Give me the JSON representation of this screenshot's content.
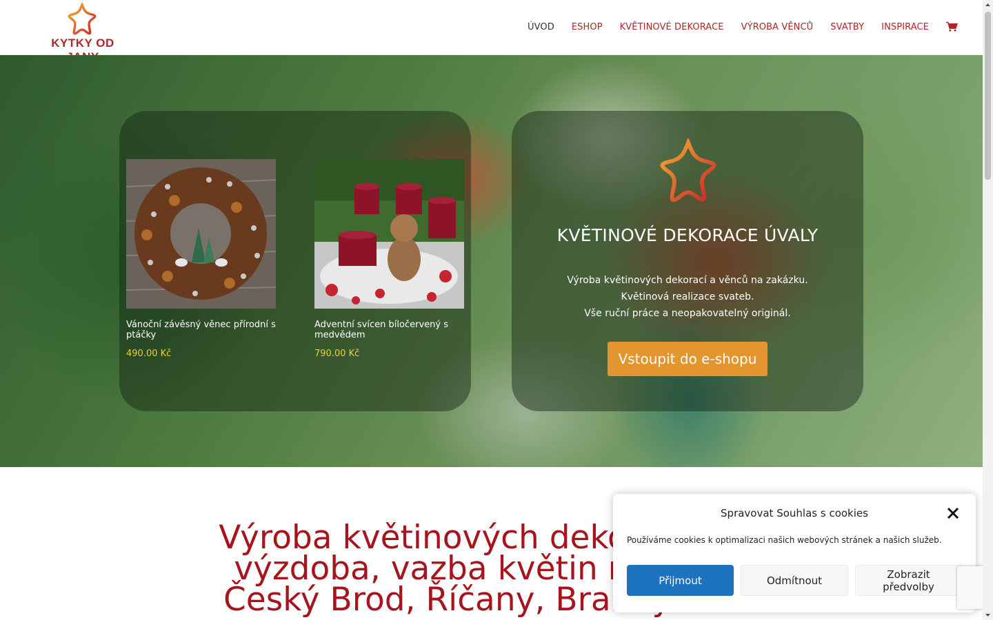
{
  "brand": {
    "name": "KYTKY OD JANY"
  },
  "nav": {
    "items": [
      {
        "label": "ÚVOD"
      },
      {
        "label": "ESHOP"
      },
      {
        "label": "KVĚTINOVÉ  DEKORACE"
      },
      {
        "label": "VÝROBA VĚNCŮ"
      },
      {
        "label": "SVATBY"
      },
      {
        "label": "INSPIRACE"
      }
    ],
    "cart_icon": "shopping-cart-icon"
  },
  "products": [
    {
      "name": "Vánoční závěsný věnec přírodní s ptáčky",
      "price": "490.00 Kč",
      "image": "christmas-wreath"
    },
    {
      "name": "Adventní svícen bíločervený s medvědem",
      "price": "790.00 Kč",
      "image": "advent-candle-holder"
    }
  ],
  "hero": {
    "title": "KVĚTINOVÉ  DEKORACE ÚVALY",
    "lines": [
      "Výroba květinových dekorací a věnců na zakázku.",
      "Květinová realizace svateb.",
      "Vše ruční práce a neopakovatelný originál."
    ],
    "cta": "Vstoupit do e-shopu"
  },
  "section": {
    "heading_lines": [
      "Výroba květinových dekorací, sva",
      "výzdoba, vazba květin na objed",
      "Český Brod, Říčany, Brandýs nad"
    ]
  },
  "cookie": {
    "title": "Spravovat Souhlas s cookies",
    "text": "Používáme cookies k optimalizaci našich webových stránek a našich služeb.",
    "accept": "Přijmout",
    "deny": "Odmítnout",
    "prefs": "Zobrazit předvolby"
  },
  "colors": {
    "brand_red": "#b2232a",
    "heading_red": "#a8141c",
    "cta_orange": "#e39530",
    "accept_blue": "#1e73be",
    "price_yellow": "#e8d23c"
  }
}
